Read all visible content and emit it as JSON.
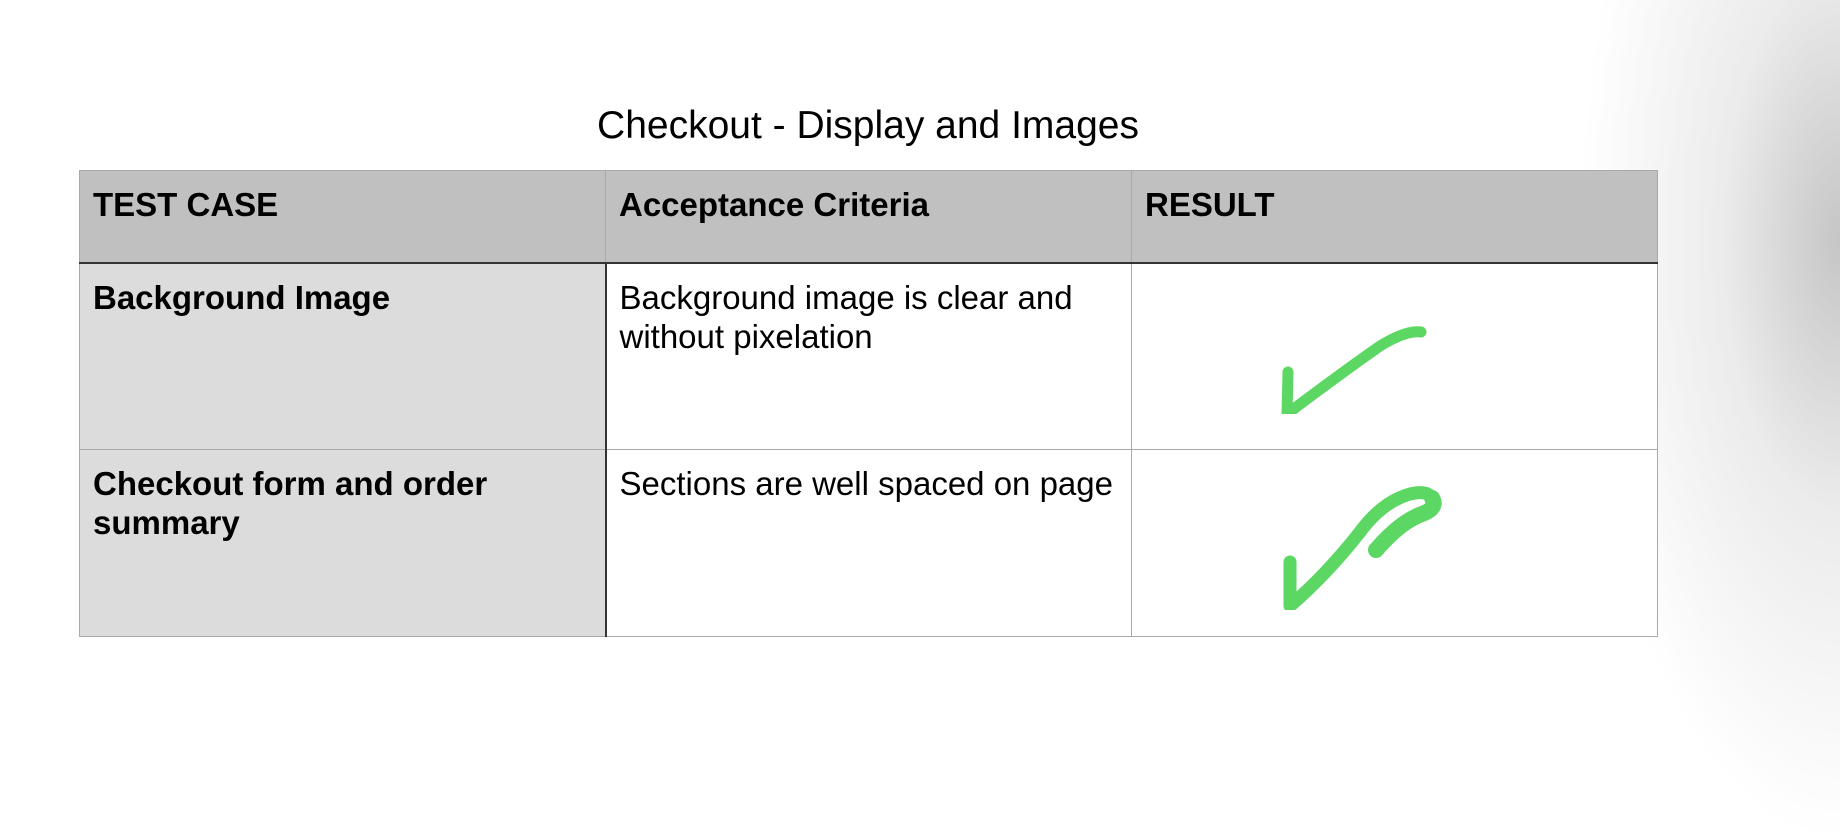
{
  "title": "Checkout - Display and Images",
  "table": {
    "headers": [
      "TEST CASE",
      "Acceptance Criteria",
      "RESULT"
    ],
    "rows": [
      {
        "test_case": "Background Image",
        "criteria": "Background image is clear and without pixelation",
        "result_icon": "green-checkmark-icon"
      },
      {
        "test_case": "Checkout form and order summary",
        "criteria": "Sections are well spaced on page",
        "result_icon": "green-checkmark-icon"
      }
    ]
  },
  "colors": {
    "header_bg": "#bfc0bf",
    "case_col_bg": "#dcdcdc",
    "check_green": "#5cd764"
  }
}
